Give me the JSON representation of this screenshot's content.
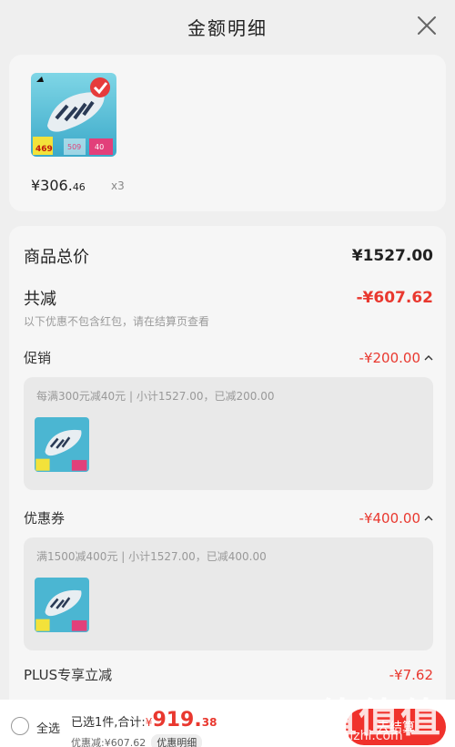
{
  "header": {
    "title": "金额明细"
  },
  "product": {
    "price_main": "¥306.",
    "price_cents": "46",
    "quantity": "x3",
    "thumb_price": "469",
    "thumb_badge_1": "509",
    "thumb_badge_2": "40"
  },
  "summary": {
    "total_label": "商品总价",
    "total_value": "¥1527.00",
    "reduce_label": "共减",
    "reduce_value": "-¥607.62",
    "note": "以下优惠不包含红包，请在结算页查看"
  },
  "promotion": {
    "label": "促销",
    "value": "-¥200.00",
    "detail": "每满300元减40元 | 小计1527.00，已减200.00"
  },
  "coupon": {
    "label": "优惠券",
    "value": "-¥400.00",
    "detail": "满1500减400元 | 小计1527.00，已减400.00"
  },
  "plus": {
    "label": "PLUS专享立减",
    "value": "-¥7.62"
  },
  "bottom": {
    "select_all": "全选",
    "selected_prefix": "已选1件,合计:",
    "total_currency": "¥",
    "total_big": "919.",
    "total_small": "38",
    "discount": "优惠减:¥607.62",
    "detail_chip": "优惠明细",
    "checkout": "去结算"
  },
  "watermark": {
    "logo": "值值值",
    "text": "zhizhizhi.com"
  },
  "colors": {
    "accent_red": "#e9382f",
    "background": "#efefef"
  }
}
